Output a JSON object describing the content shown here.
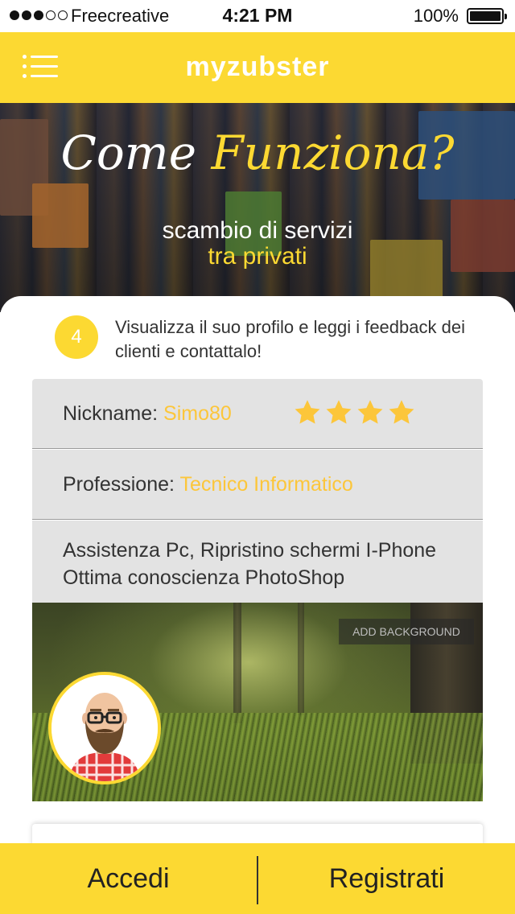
{
  "status_bar": {
    "carrier": "Freecreative",
    "time": "4:21 PM",
    "battery": "100%",
    "signal_bars_filled": 3,
    "signal_bars_total": 5
  },
  "header": {
    "title": "myzubster",
    "menu_icon": "hamburger-menu-icon",
    "background": "#fcd932"
  },
  "hero": {
    "title_part1": "Come",
    "title_part2": "Funziona?",
    "subtitle_line1": "scambio di servizi",
    "subtitle_line2": "tra privati"
  },
  "step": {
    "number": "4",
    "text": "Visualizza il suo profilo e leggi i feedback dei clienti e contattalo!"
  },
  "profile": {
    "nickname_label": "Nickname:",
    "nickname_value": "Simo80",
    "rating": 4,
    "rating_max": 4,
    "profession_label": "Professione:",
    "profession_value": "Tecnico Informatico",
    "description_line1": "Assistenza Pc, Ripristino schermi I-Phone",
    "description_line2": "Ottima conoscienza PhotoShop",
    "add_background_label": "ADD BACKGROUND",
    "avatar_icon": "bearded-man-avatar-icon"
  },
  "bottom_bar": {
    "login_label": "Accedi",
    "register_label": "Registrati"
  },
  "colors": {
    "accent_yellow": "#fcd932",
    "value_yellow": "#fcc63a",
    "row_gray": "#e3e3e3"
  }
}
